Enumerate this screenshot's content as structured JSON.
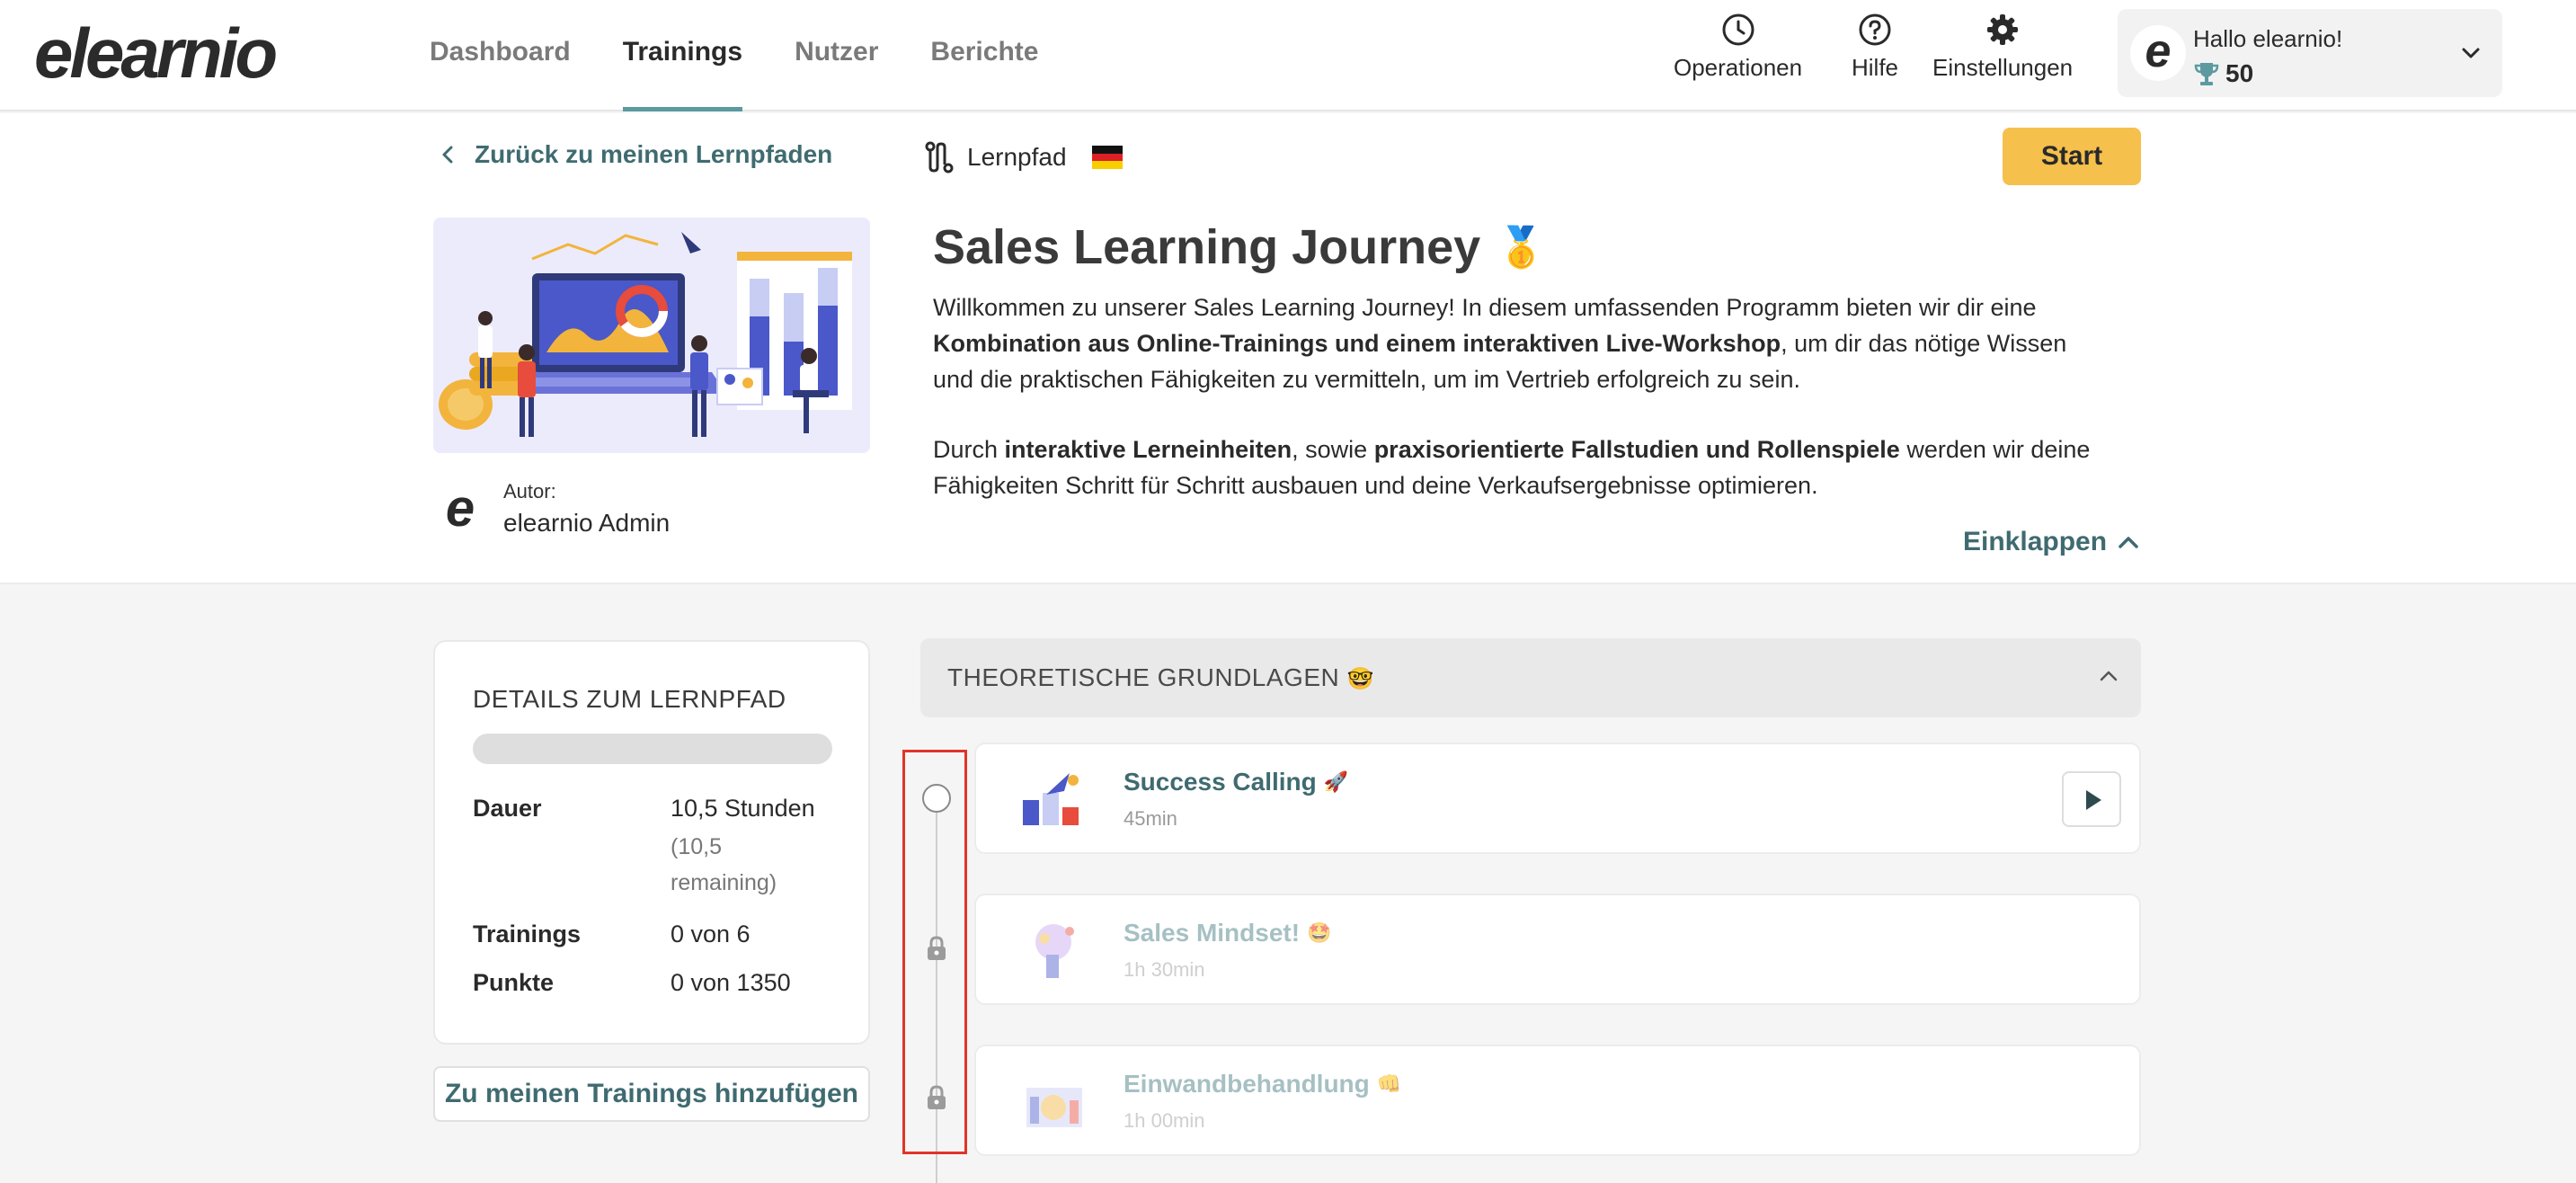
{
  "brand": {
    "logo_text": "elearnio",
    "accent": "#5c9aa0",
    "link_color": "#3f6b70",
    "cta_color": "#f5c04c"
  },
  "nav": {
    "items": [
      {
        "label": "Dashboard",
        "active": false
      },
      {
        "label": "Trainings",
        "active": true
      },
      {
        "label": "Nutzer",
        "active": false
      },
      {
        "label": "Berichte",
        "active": false
      }
    ]
  },
  "top_actions": {
    "operations": {
      "label": "Operationen",
      "icon": "clock-icon"
    },
    "help": {
      "label": "Hilfe",
      "icon": "question-circle-icon"
    },
    "settings": {
      "label": "Einstellungen",
      "icon": "gear-icon"
    }
  },
  "user": {
    "avatar_letter": "e",
    "greeting": "Hallo elearnio!",
    "points": "50",
    "points_icon": "trophy-icon"
  },
  "hero": {
    "back_label": "Zurück zu meinen Lernpfaden",
    "type_label": "Lernpfad",
    "language_flag": "flag-de-icon",
    "start_label": "Start",
    "title": "Sales Learning Journey",
    "title_emoji": "🥇",
    "desc_p1_a": "Willkommen zu unserer Sales Learning Journey! In diesem umfassenden Programm bieten wir dir eine ",
    "desc_p1_b": "Kombination aus Online-Trainings und einem interaktiven Live-Workshop",
    "desc_p1_c": ", um dir das nötige Wissen und die praktischen Fähigkeiten zu vermitteln, um im Vertrieb erfolgreich zu sein.",
    "desc_p2_a": "Durch ",
    "desc_p2_b": "interaktive Lerneinheiten",
    "desc_p2_c": ", sowie ",
    "desc_p2_d": "praxisorientierte Fallstudien und Rollenspiele",
    "desc_p2_e": " werden wir deine Fähigkeiten Schritt für Schritt ausbauen und deine Verkaufsergebnisse optimieren.",
    "collapse_label": "Einklappen",
    "author_label": "Autor:",
    "author_name": "elearnio Admin",
    "author_logo": "e"
  },
  "details": {
    "title": "DETAILS ZUM LERNPFAD",
    "progress_fraction": 0,
    "duration_label": "Dauer",
    "duration_value": "10,5 Stunden",
    "duration_sub_1": "(10,5",
    "duration_sub_2": "remaining)",
    "trainings_label": "Trainings",
    "trainings_value": "0 von 6",
    "points_label": "Punkte",
    "points_value": "0 von 1350",
    "add_button": "Zu meinen Trainings hinzufügen"
  },
  "section": {
    "title": "THEORETISCHE GRUNDLAGEN",
    "emoji": "🤓",
    "items": [
      {
        "title": "Success Calling",
        "emoji": "🚀",
        "duration": "45min",
        "locked": false
      },
      {
        "title": "Sales Mindset!",
        "emoji": "🤩",
        "duration": "1h 30min",
        "locked": true
      },
      {
        "title": "Einwandbehandlung",
        "emoji": "👊",
        "duration": "1h 00min",
        "locked": true
      }
    ]
  }
}
